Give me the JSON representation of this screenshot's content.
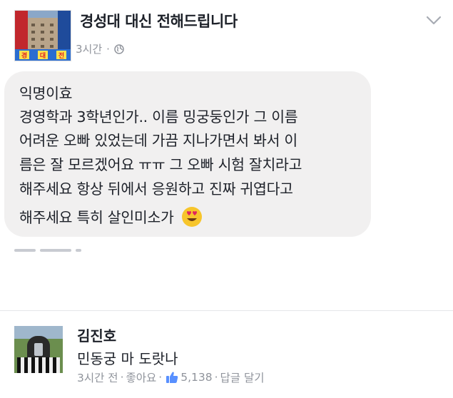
{
  "post": {
    "page_name": "경성대 대신 전해드립니다",
    "time": "3시간",
    "separator": "·",
    "avatar_banner": [
      "경",
      "대",
      "전"
    ]
  },
  "message": {
    "lines": [
      "익명이효",
      "경영학과 3학년인가.. 이름 밍궁둥인가 그 이름",
      "어려운 오빠 있었는데 가끔 지나가면서 봐서 이",
      "름은 잘 모르겠어요 ㅠㅠ 그 오빠 시험 잘치라고",
      "해주세요 항상 뒤에서 응원하고 진짜 귀엽다고",
      "해주세요 특히 살인미소가"
    ],
    "emoji": "heart-eyes-icon"
  },
  "comment": {
    "name": "김진호",
    "text": "민동궁 마 도랏나",
    "time": "3시간 전",
    "separator": "·",
    "like_label": "좋아요",
    "like_count": "5,138",
    "reply_label": "답글 달기"
  },
  "icons": {
    "globe": "globe-icon",
    "menu": "chevron-down-icon",
    "like": "like-thumb-icon"
  },
  "colors": {
    "bubble": "#f1f0f0",
    "meta_text": "#90949c",
    "like_blue": "#5890ff"
  }
}
